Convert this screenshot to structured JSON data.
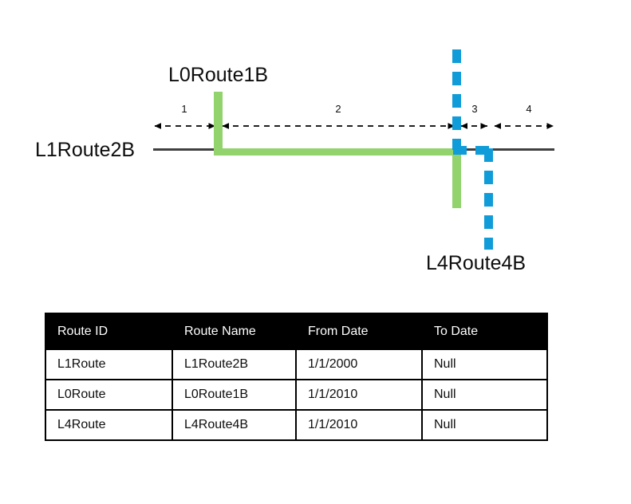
{
  "diagram": {
    "labels": {
      "top_route": "L0Route1B",
      "base_route": "L1Route2B",
      "branch_route": "L4Route4B"
    },
    "segment_numbers": [
      "1",
      "2",
      "3",
      "4"
    ],
    "colors": {
      "green_route": "#92D36E",
      "blue_route": "#109CD8",
      "base_line": "#404040",
      "arrow": "#000000",
      "text": "#0D0D0D"
    }
  },
  "table": {
    "headers": [
      "Route ID",
      "Route Name",
      "From Date",
      "To Date"
    ],
    "rows": [
      [
        "L1Route",
        "L1Route2B",
        "1/1/2000",
        "Null"
      ],
      [
        "L0Route",
        "L0Route1B",
        "1/1/2010",
        "Null"
      ],
      [
        "L4Route",
        "L4Route4B",
        "1/1/2010",
        "Null"
      ]
    ],
    "header_background": "#000000",
    "header_text_color": "#FFFFFF"
  }
}
